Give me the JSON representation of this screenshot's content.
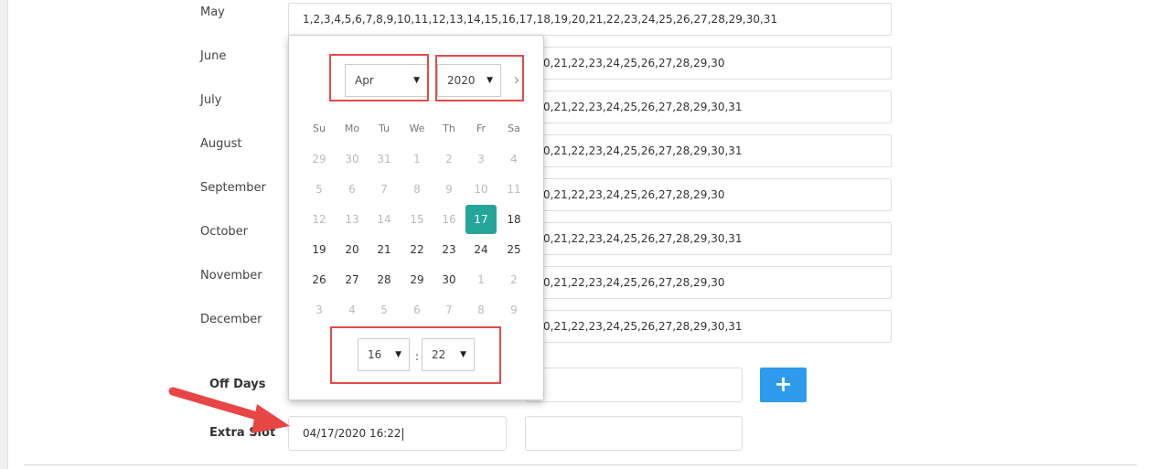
{
  "months": [
    {
      "name": "May",
      "days": "1,2,3,4,5,6,7,8,9,10,11,12,13,14,15,16,17,18,19,20,21,22,23,24,25,26,27,28,29,30,31"
    },
    {
      "name": "June",
      "days": "0,21,22,23,24,25,26,27,28,29,30"
    },
    {
      "name": "July",
      "days": "0,21,22,23,24,25,26,27,28,29,30,31"
    },
    {
      "name": "August",
      "days": "0,21,22,23,24,25,26,27,28,29,30,31"
    },
    {
      "name": "September",
      "days": "0,21,22,23,24,25,26,27,28,29,30"
    },
    {
      "name": "October",
      "days": "0,21,22,23,24,25,26,27,28,29,30,31"
    },
    {
      "name": "November",
      "days": "0,21,22,23,24,25,26,27,28,29,30"
    },
    {
      "name": "December",
      "days": "0,21,22,23,24,25,26,27,28,29,30,31"
    }
  ],
  "off_days": {
    "label": "Off Days",
    "add_label": "+"
  },
  "extra_slot": {
    "label": "Extra Slot",
    "value": "04/17/2020 16:22"
  },
  "picker": {
    "month": "Apr",
    "year": "2020",
    "weekdays": [
      "Su",
      "Mo",
      "Tu",
      "We",
      "Th",
      "Fr",
      "Sa"
    ],
    "weeks": [
      [
        "29",
        "30",
        "31",
        "1",
        "2",
        "3",
        "4"
      ],
      [
        "5",
        "6",
        "7",
        "8",
        "9",
        "10",
        "11"
      ],
      [
        "12",
        "13",
        "14",
        "15",
        "16",
        "17",
        "18"
      ],
      [
        "19",
        "20",
        "21",
        "22",
        "23",
        "24",
        "25"
      ],
      [
        "26",
        "27",
        "28",
        "29",
        "30",
        "1",
        "2"
      ],
      [
        "3",
        "4",
        "5",
        "6",
        "7",
        "8",
        "9"
      ]
    ],
    "muted": [
      [
        true,
        true,
        true,
        true,
        true,
        true,
        true
      ],
      [
        true,
        true,
        true,
        true,
        true,
        true,
        true
      ],
      [
        true,
        true,
        true,
        true,
        true,
        false,
        false
      ],
      [
        false,
        false,
        false,
        false,
        false,
        false,
        false
      ],
      [
        false,
        false,
        false,
        false,
        false,
        true,
        true
      ],
      [
        true,
        true,
        true,
        true,
        true,
        true,
        true
      ]
    ],
    "selected": {
      "row": 2,
      "col": 5
    },
    "hour": "16",
    "minute": "22",
    "time_separator": ":"
  },
  "colors": {
    "accent": "#26a69a",
    "add_button": "#2e9bed",
    "highlight": "#e34b4b"
  }
}
